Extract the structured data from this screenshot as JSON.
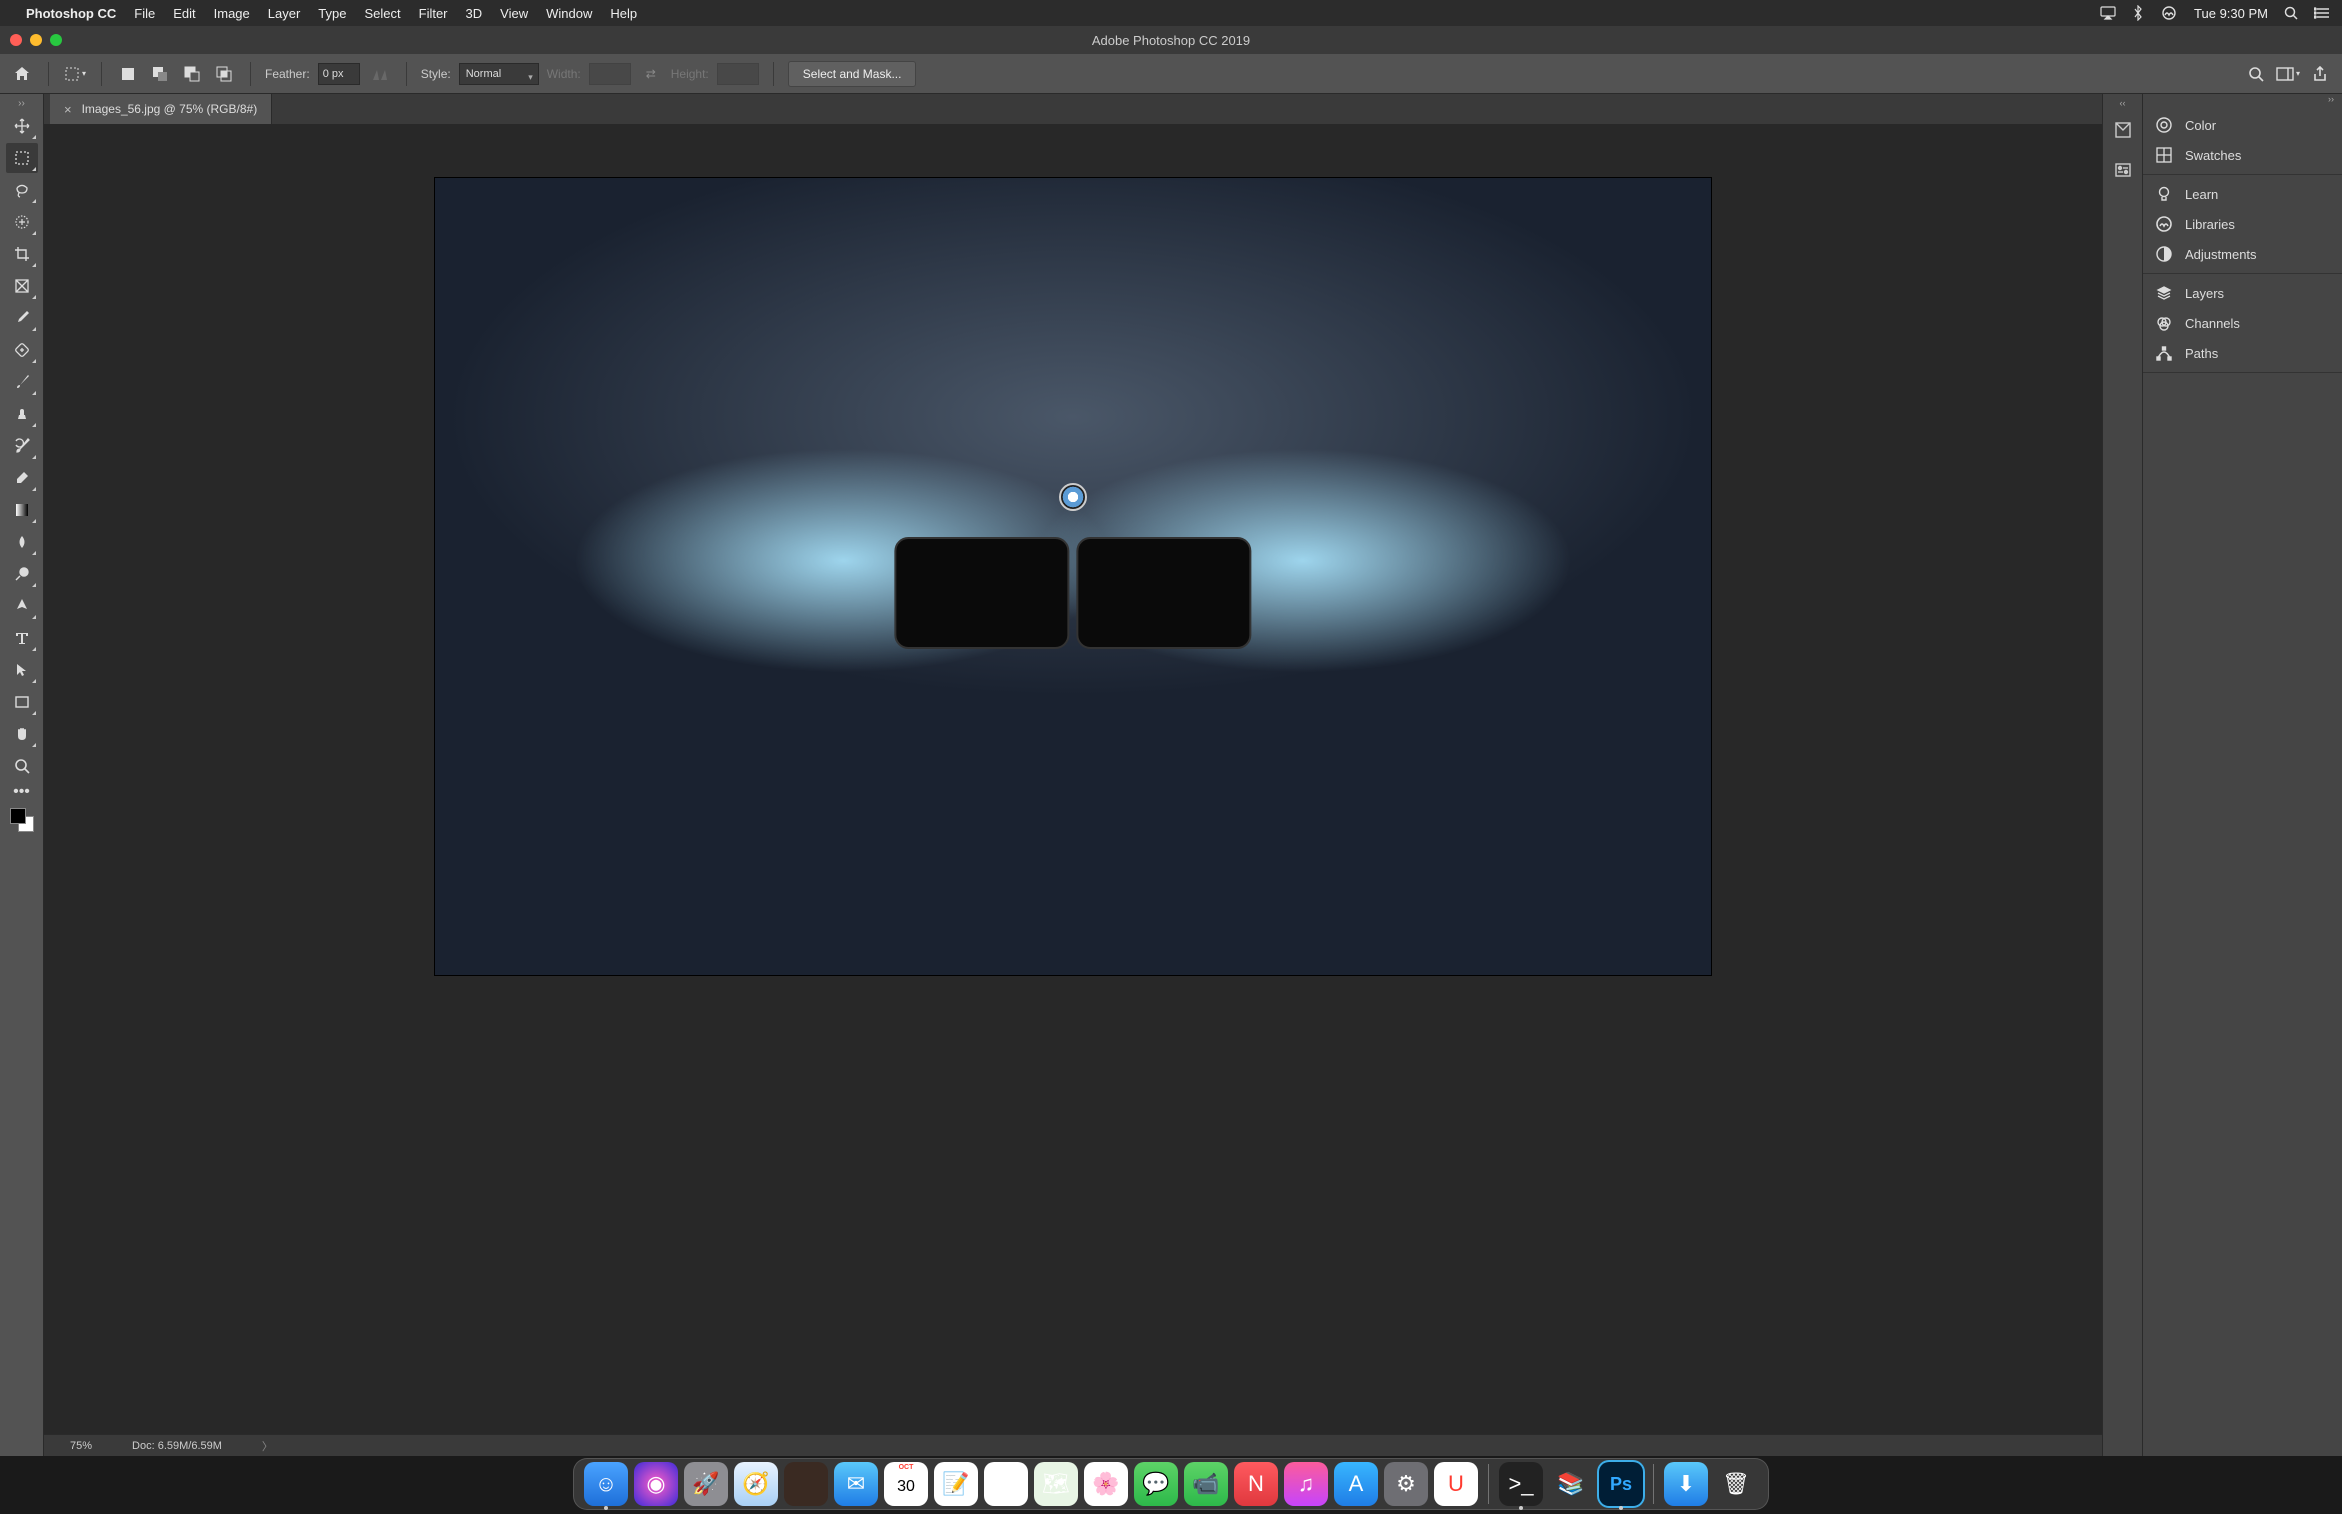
{
  "menubar": {
    "app_name": "Photoshop CC",
    "items": [
      "File",
      "Edit",
      "Image",
      "Layer",
      "Type",
      "Select",
      "Filter",
      "3D",
      "View",
      "Window",
      "Help"
    ],
    "clock": "Tue 9:30 PM"
  },
  "window": {
    "title": "Adobe Photoshop CC 2019"
  },
  "options": {
    "feather_label": "Feather:",
    "feather_value": "0 px",
    "style_label": "Style:",
    "style_value": "Normal",
    "width_label": "Width:",
    "height_label": "Height:",
    "select_mask_btn": "Select and Mask..."
  },
  "doc_tab": {
    "label": "Images_56.jpg @ 75% (RGB/8#)"
  },
  "status": {
    "zoom": "75%",
    "doc_info": "Doc: 6.59M/6.59M"
  },
  "tools": [
    "move",
    "marquee",
    "lasso",
    "quick-select",
    "crop",
    "frame",
    "eyedropper",
    "healing",
    "brush",
    "clone",
    "history-brush",
    "eraser",
    "gradient",
    "blur",
    "dodge",
    "pen",
    "type",
    "path-select",
    "rectangle",
    "hand",
    "zoom"
  ],
  "right_panels": {
    "group1": [
      "Color",
      "Swatches"
    ],
    "group2": [
      "Learn",
      "Libraries",
      "Adjustments"
    ],
    "group3": [
      "Layers",
      "Channels",
      "Paths"
    ]
  },
  "dock": [
    {
      "name": "finder",
      "glyph": "☺",
      "bg": "linear-gradient(#4aa3ff,#1e6fd9)",
      "running": true
    },
    {
      "name": "siri",
      "glyph": "◉",
      "bg": "radial-gradient(circle,#ff5ec7,#3b2bd9)"
    },
    {
      "name": "launchpad",
      "glyph": "🚀",
      "bg": "#8e8e93"
    },
    {
      "name": "safari",
      "glyph": "🧭",
      "bg": "linear-gradient(#e8f3ff,#a9d0f5)"
    },
    {
      "name": "photoshop-doc",
      "glyph": "",
      "bg": "#3a2a22"
    },
    {
      "name": "mail",
      "glyph": "✉",
      "bg": "linear-gradient(#5ac8fa,#1f7de6)"
    },
    {
      "name": "calendar",
      "glyph": "30",
      "bg": "#fff",
      "text_color": "#000"
    },
    {
      "name": "notes",
      "glyph": "📝",
      "bg": "#fff"
    },
    {
      "name": "reminders",
      "glyph": "▤",
      "bg": "#fff"
    },
    {
      "name": "maps",
      "glyph": "🗺",
      "bg": "#e8f5e5"
    },
    {
      "name": "photos",
      "glyph": "🌸",
      "bg": "#fff"
    },
    {
      "name": "messages",
      "glyph": "💬",
      "bg": "linear-gradient(#5dd367,#2db94a)"
    },
    {
      "name": "facetime",
      "glyph": "📹",
      "bg": "linear-gradient(#5dd367,#2db94a)"
    },
    {
      "name": "news",
      "glyph": "N",
      "bg": "linear-gradient(#ff5a5f,#e0383e)"
    },
    {
      "name": "music",
      "glyph": "♫",
      "bg": "linear-gradient(#fc5c9c,#c644fc)"
    },
    {
      "name": "appstore",
      "glyph": "A",
      "bg": "linear-gradient(#38b6ff,#1f7de6)"
    },
    {
      "name": "preferences",
      "glyph": "⚙",
      "bg": "#6e6e73"
    },
    {
      "name": "magnet",
      "glyph": "U",
      "bg": "#fff",
      "text_color": "#ff3b30"
    },
    {
      "name": "terminal",
      "glyph": ">_",
      "bg": "#222",
      "running": true
    },
    {
      "name": "books-stack",
      "glyph": "📚",
      "bg": "transparent"
    },
    {
      "name": "photoshop",
      "glyph": "Ps",
      "bg": "#001e36",
      "text_color": "#31a8ff",
      "running": true,
      "active": true
    },
    {
      "name": "downloads",
      "glyph": "⬇",
      "bg": "linear-gradient(#5ac8fa,#1f7de6)"
    },
    {
      "name": "trash",
      "glyph": "🗑",
      "bg": "transparent"
    }
  ]
}
